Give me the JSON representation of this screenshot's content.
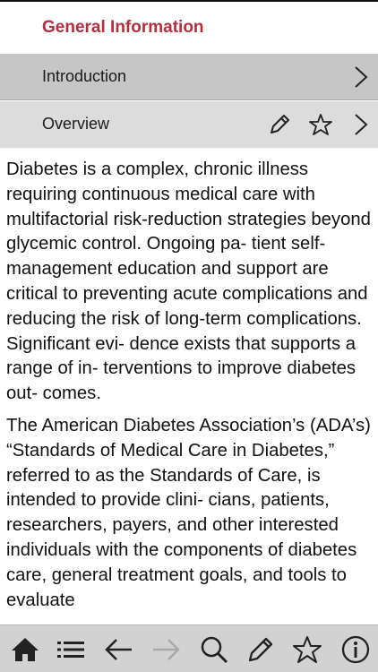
{
  "header": {
    "title": "General Information"
  },
  "nav": {
    "items": [
      {
        "label": "Introduction"
      },
      {
        "label": "Overview"
      }
    ]
  },
  "content": {
    "paragraphs": [
      "Diabetes is a complex, chronic illness requiring continuous medical care with multifactorial risk-reduction strategies beyond glycemic control. Ongoing pa- tient self-management education and support are critical to preventing acute complications and reducing the risk of long-term complications. Significant evi- dence exists that supports a range of in- terventions to improve diabetes out- comes.",
      "The American Diabetes Association’s (ADA’s) “Standards of Medical Care in Diabetes,” referred to as the Standards of Care, is intended to provide clini- cians, patients, researchers, payers, and other interested individuals with the components of diabetes care, general treatment goals, and tools to evaluate"
    ]
  },
  "toolbar": {
    "icons": [
      "home-icon",
      "list-icon",
      "back-arrow-icon",
      "forward-arrow-icon",
      "search-icon",
      "edit-icon",
      "star-icon",
      "info-icon"
    ]
  },
  "colors": {
    "accent": "#b0303d",
    "intro_row": "#c6c6c6",
    "overview_row": "#dcdcdc",
    "toolbar": "#d2d2d2",
    "disabled_icon": "#a8a8a8"
  }
}
